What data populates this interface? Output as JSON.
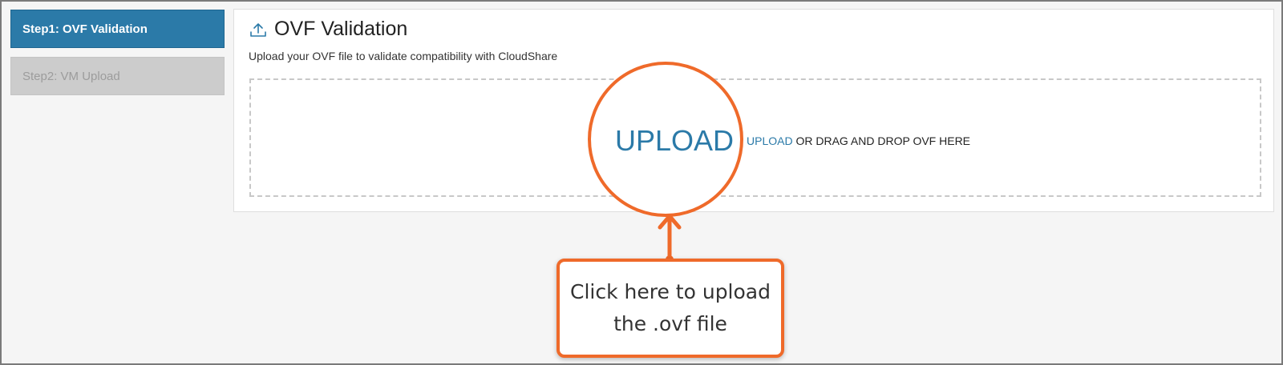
{
  "sidebar": {
    "steps": [
      {
        "label": "Step1: OVF Validation",
        "state": "active"
      },
      {
        "label": "Step2: VM Upload",
        "state": "disabled"
      }
    ]
  },
  "main": {
    "title": "OVF Validation",
    "title_icon": "upload-icon",
    "subtitle": "Upload your OVF file to validate compatibility with CloudShare",
    "dropzone": {
      "link_text": "UPLOAD",
      "rest_text": " OR DRAG AND DROP OVF HERE"
    }
  },
  "annotation": {
    "magnified_link": "UPLOAD",
    "magnified_rest": " O",
    "callout_text": "Click here to upload the .ovf file"
  },
  "colors": {
    "accent": "#2b7aa8",
    "callout_border": "#ef6a2a",
    "disabled_step": "#cccccc"
  }
}
